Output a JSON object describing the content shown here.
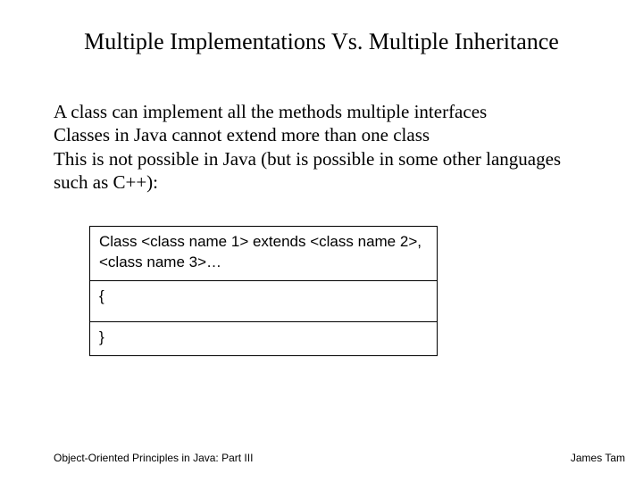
{
  "title": "Multiple Implementations Vs. Multiple Inheritance",
  "body": {
    "line1": "A class can implement all the methods multiple interfaces",
    "line2": "Classes in Java cannot extend more than one class",
    "line3": "This is not possible in Java (but is possible in some other languages such as C++):"
  },
  "code": {
    "row1": "Class <class name 1> extends <class name 2>, <class name 3>…",
    "row2": "{",
    "row3": "}"
  },
  "footer": {
    "left": "Object-Oriented Principles in Java: Part III",
    "right": "James Tam"
  }
}
